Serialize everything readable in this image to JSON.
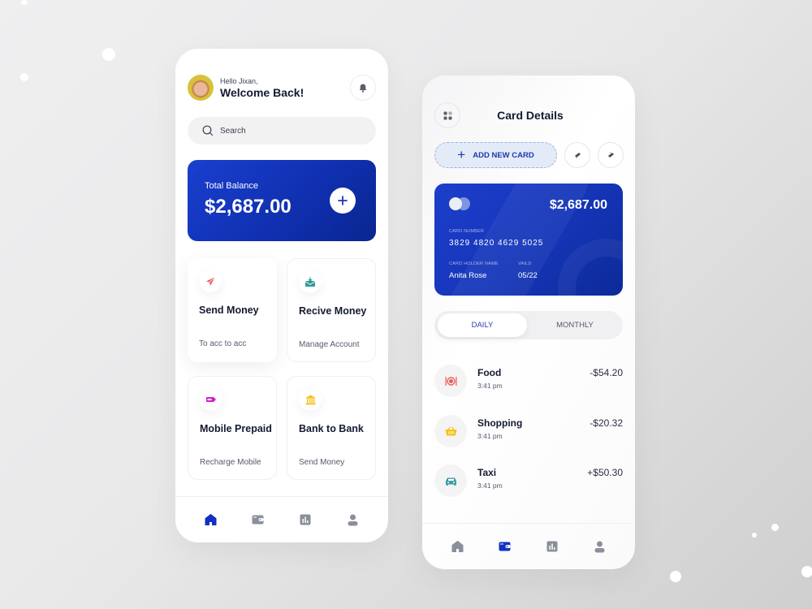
{
  "home": {
    "greeting": "Hello Jixan,",
    "welcome": "Welcome Back!",
    "search": {
      "placeholder": "Search"
    },
    "balance": {
      "label": "Total Balance",
      "value": "$2,687.00"
    },
    "tiles": [
      {
        "title": "Send Money",
        "subtitle": "To acc to acc",
        "icon": "paper-plane-icon",
        "icon_color": "#f0595a"
      },
      {
        "title": "Recive Money",
        "subtitle": "Manage Account",
        "icon": "receive-envelope-icon",
        "icon_color": "#2f9a9a"
      },
      {
        "title": "Mobile Prepaid",
        "subtitle": "Recharge Mobile",
        "icon": "prepaid-card-icon",
        "icon_color": "#d21fc9"
      },
      {
        "title": "Bank to Bank",
        "subtitle": "Send Money",
        "icon": "bank-icon",
        "icon_color": "#f4c21b"
      }
    ],
    "nav": [
      "home",
      "wallet",
      "stats",
      "profile"
    ],
    "nav_active": "home"
  },
  "card_details": {
    "title": "Card Details",
    "add_card_label": "ADD NEW CARD",
    "card": {
      "amount": "$2,687.00",
      "number_label": "CARD NUMBER",
      "number": "3829 4820 4629 5025",
      "holder_label": "CARD HOLDER NAME",
      "holder": "Anita Rose",
      "valid_label": "VAILD",
      "valid": "05/22"
    },
    "tabs": [
      {
        "label": "DAILY",
        "active": true
      },
      {
        "label": "MONTHLY",
        "active": false
      }
    ],
    "transactions": [
      {
        "name": "Food",
        "time": "3:41 pm",
        "amount": "-$54.20",
        "icon": "food-plate-icon",
        "icon_color": "#ef5a5a"
      },
      {
        "name": "Shopping",
        "time": "3:41 pm",
        "amount": "-$20.32",
        "icon": "shopping-basket-icon",
        "icon_color": "#f2c417"
      },
      {
        "name": "Taxi",
        "time": "3:41 pm",
        "amount": "+$50.30",
        "icon": "taxi-car-icon",
        "icon_color": "#3a9aa0"
      }
    ],
    "nav": [
      "home",
      "wallet",
      "stats",
      "profile"
    ],
    "nav_active": "wallet"
  },
  "colors": {
    "primary": "#1535b8",
    "nav_active": "#1231c4",
    "nav_inactive": "#8b8f9b",
    "text_dark": "#151a33"
  }
}
